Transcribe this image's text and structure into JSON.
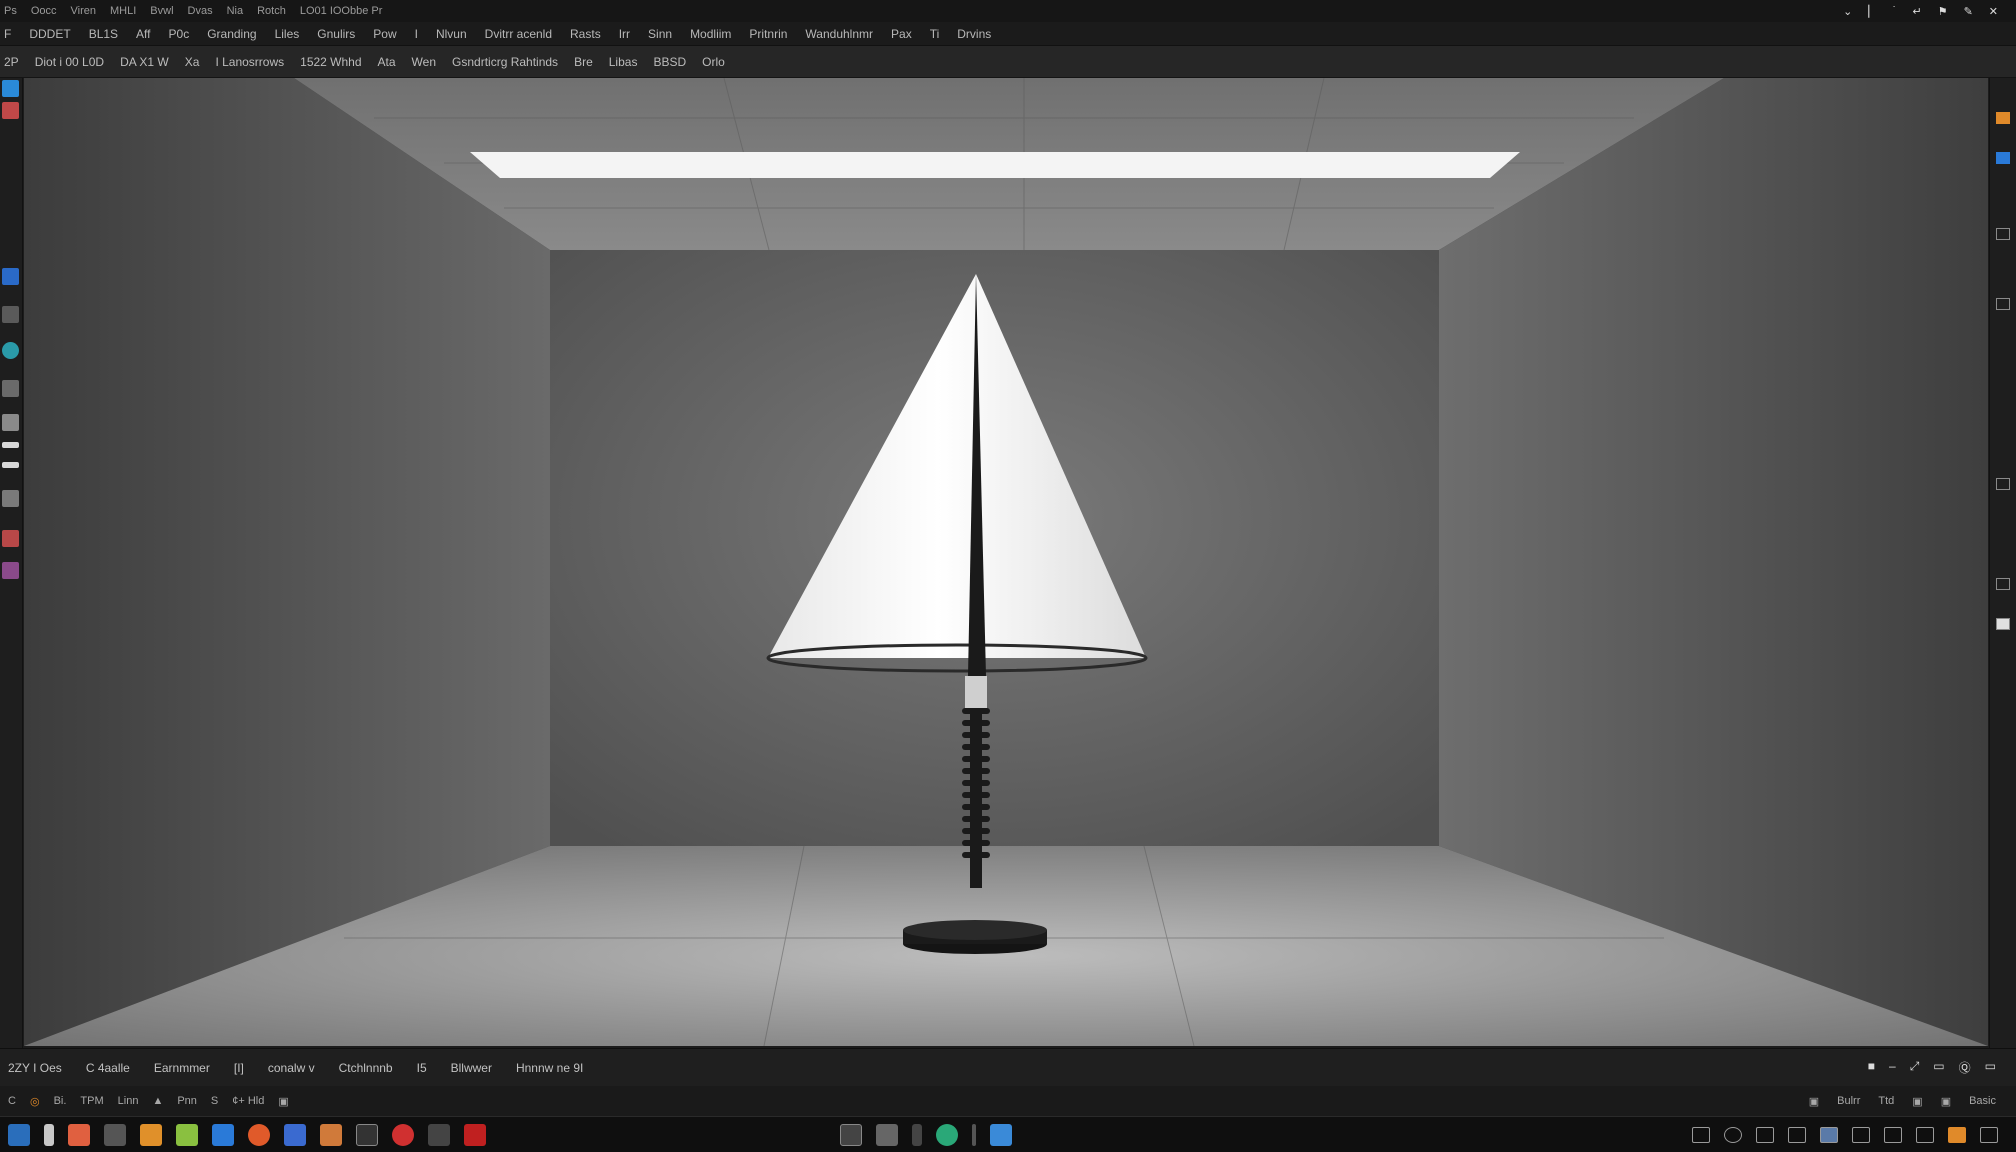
{
  "titlebar": {
    "items": [
      "Ps",
      "Oocc",
      "Viren",
      "MHLI",
      "Bvwl",
      "Dvas",
      "Nia",
      "Rotch",
      "LO01 IOObbe Pr"
    ],
    "window_controls": [
      "minimize",
      "restore",
      "maximize",
      "fullscreen",
      "pin",
      "share",
      "close"
    ]
  },
  "menubar": {
    "items": [
      "F",
      "DDDET",
      "BL1S",
      "Aff",
      "P0c",
      "Granding",
      "Liles",
      "Gnulirs",
      "Pow",
      "I",
      "Nlvun",
      "Dvitrr acenld",
      "Rasts",
      "Irr",
      "Sinn",
      "Modliim",
      "Pritnrin",
      "Wanduhlnmr",
      "Pax",
      "Ti",
      "Drvins"
    ]
  },
  "options": {
    "items": [
      "2P",
      "Diot i 00 L0D",
      "DA X1 W",
      "Xa",
      "I Lanosrrows",
      "1522 Whhd",
      "Ata",
      "Wen",
      "Gsndrticrg Rahtinds",
      "Bre",
      "Libas",
      "BBSD",
      "Orlo"
    ]
  },
  "left_tools": [
    "move-tool",
    "marquee-tool",
    "lasso-tool",
    "crop-tool",
    "brush-tool",
    "stamp-tool",
    "eraser-tool",
    "gradient-tool",
    "type-tool",
    "shape-tool",
    "hand-tool",
    "zoom-tool"
  ],
  "right_panel": [
    "color-swatch",
    "layers",
    "channels",
    "paths",
    "properties",
    "adjustments",
    "history"
  ],
  "canvas": {
    "description_colors": {
      "wall": "#5a5a5a",
      "light": "#f4f4f4",
      "lamp": "#1a1a1a"
    }
  },
  "statusbar": {
    "items": [
      "2ZY I Oes",
      "C 4aalle",
      "Earnmmer",
      "[I]",
      "conalw v",
      "Ctchlnnnb",
      "I5",
      "Bllwwer",
      "Hnnnw ne 9I"
    ],
    "right_items": [
      "■",
      "–",
      "⤢",
      "▭",
      "Ⓠ",
      "▭"
    ]
  },
  "timeline": {
    "items": [
      "C",
      "◎",
      "Bi.",
      "TPM",
      "Linn",
      "▲",
      "Pnn",
      "S",
      "¢+ Hld",
      "▣"
    ],
    "right_items": [
      "▣",
      "Bulrr",
      "Ttd",
      "▣",
      "▣",
      "Basic"
    ]
  },
  "taskbar": {
    "apps": [
      {
        "name": "photoshop",
        "color": "#2a6ebb"
      },
      {
        "name": "flash",
        "color": "#c8c8c8"
      },
      {
        "name": "document",
        "color": "#e06040"
      },
      {
        "name": "viewer",
        "color": "#555555"
      },
      {
        "name": "folder",
        "color": "#e0902a"
      },
      {
        "name": "notes",
        "color": "#8ac040"
      },
      {
        "name": "mail",
        "color": "#2a7ad8"
      },
      {
        "name": "browser",
        "color": "#e05a2a"
      },
      {
        "name": "app-blue",
        "color": "#3a6ad0"
      },
      {
        "name": "files",
        "color": "#d07a3a"
      },
      {
        "name": "media",
        "color": "#333333"
      },
      {
        "name": "opera",
        "color": "#d03030"
      },
      {
        "name": "grid",
        "color": "#444444"
      },
      {
        "name": "pdf",
        "color": "#c02020"
      }
    ],
    "center_apps": [
      {
        "name": "up-arrow",
        "color": "#444444"
      },
      {
        "name": "pen",
        "color": "#666666"
      },
      {
        "name": "bin",
        "color": "#444444"
      },
      {
        "name": "globe",
        "color": "#2aa878"
      },
      {
        "name": "slash",
        "color": "#555555"
      },
      {
        "name": "cloud",
        "color": "#3a8ad8"
      }
    ],
    "tray": [
      "chevron-left",
      "link",
      "circle",
      "table",
      "screen",
      "display",
      "settings",
      "network",
      "brush",
      "battery",
      "volume"
    ]
  }
}
